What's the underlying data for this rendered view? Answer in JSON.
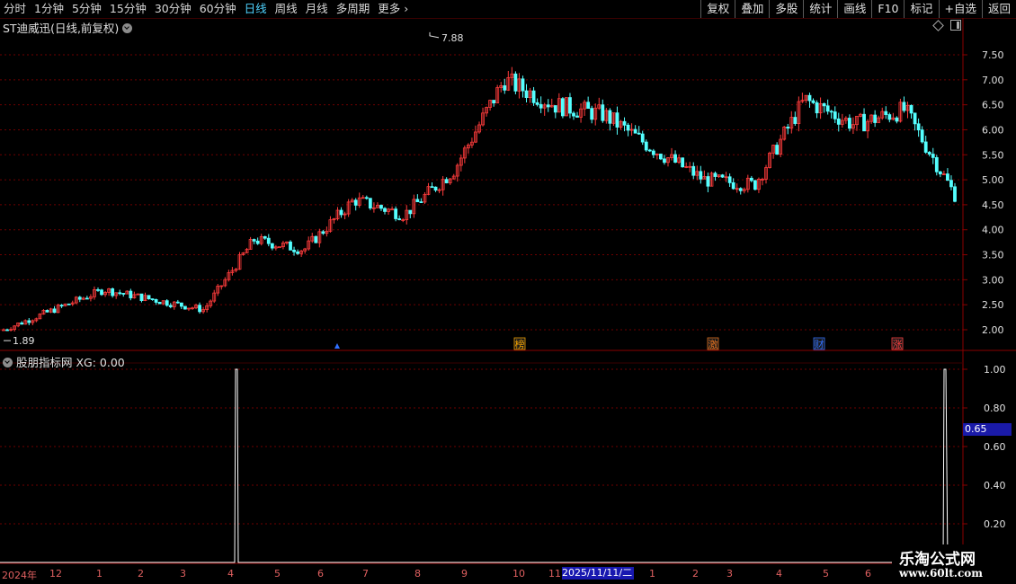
{
  "toolbar": {
    "periods": [
      "分时",
      "1分钟",
      "5分钟",
      "15分钟",
      "30分钟",
      "60分钟",
      "日线",
      "周线",
      "月线",
      "多周期",
      "更多"
    ],
    "active_period": "日线",
    "tools": [
      "复权",
      "叠加",
      "多股",
      "统计",
      "画线",
      "F10",
      "标记",
      "+自选",
      "返回"
    ]
  },
  "main_chart": {
    "stock_title": "ST迪威迅(日线,前复权)",
    "high_label": "7.88",
    "low_label": "1.89",
    "event_markers": [
      {
        "label": "榜",
        "color": "#f0a000"
      },
      {
        "label": "激",
        "color": "#e07020"
      },
      {
        "label": "财",
        "color": "#3070ff"
      },
      {
        "label": "涨",
        "color": "#ff4040"
      }
    ]
  },
  "indicator": {
    "title": "股朋指标网 XG: 0.00",
    "current_value": "0.65"
  },
  "time_axis": {
    "labels": [
      "2024年",
      "12",
      "1",
      "2",
      "3",
      "4",
      "5",
      "6",
      "7",
      "8",
      "9",
      "10",
      "11",
      "1",
      "2",
      "3",
      "4",
      "5",
      "6"
    ],
    "highlight": "2025/11/11/二"
  },
  "watermark": {
    "title": "乐淘公式网",
    "url": "www.60lt.com"
  },
  "chart_data": [
    {
      "type": "candlestick",
      "title": "ST迪威迅(日线,前复权)",
      "ylim": [
        1.89,
        7.88
      ],
      "y_ticks": [
        2.0,
        2.5,
        3.0,
        3.5,
        4.0,
        4.5,
        5.0,
        5.5,
        6.0,
        6.5,
        7.0,
        7.5
      ],
      "x": [
        "2024-11",
        "2024-12",
        "2025-01",
        "2025-02",
        "2025-03",
        "2025-04",
        "2025-05",
        "2025-06",
        "2025-07",
        "2025-08",
        "2025-09",
        "2025-10",
        "2025-11",
        "2025-12",
        "2026-01",
        "2026-02",
        "2026-03",
        "2026-04",
        "2026-05",
        "2026-06"
      ],
      "close_trend": [
        2.0,
        2.4,
        2.8,
        2.6,
        2.4,
        3.8,
        3.6,
        4.6,
        4.3,
        5.2,
        7.0,
        6.5,
        6.3,
        5.6,
        5.0,
        4.9,
        6.6,
        6.1,
        6.4,
        4.7
      ],
      "high": 7.88,
      "low": 1.89,
      "grid": true
    },
    {
      "type": "line",
      "title": "股朋指标网 XG",
      "ylim": [
        0,
        1
      ],
      "y_ticks": [
        0.2,
        0.4,
        0.6,
        0.8,
        1.0
      ],
      "series": [
        {
          "name": "XG",
          "spikes_at": [
            "2025-04",
            "2026-06"
          ],
          "spike_value": 1.0,
          "current": 0.0
        }
      ],
      "grid": true
    }
  ]
}
